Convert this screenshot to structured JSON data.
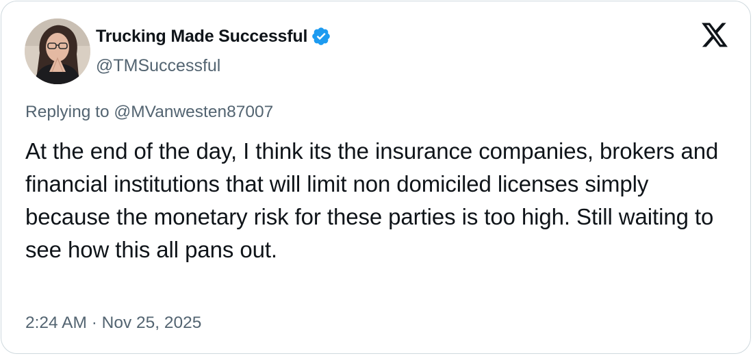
{
  "author": {
    "display_name": "Trucking Made Successful",
    "handle": "@TMSuccessful",
    "verified": true,
    "avatar_icon": "profile-photo"
  },
  "reply": {
    "prefix": "Replying to ",
    "to_handle": "@MVanwesten87007"
  },
  "tweet": {
    "text": "At the end of the day, I think its the insurance companies, brokers and financial institutions that will limit non domiciled licenses simply because the monetary risk for these parties is too high. Still waiting to see how this all pans out.",
    "timestamp": "2:24 AM · Nov 25, 2025"
  },
  "branding": {
    "logo_icon": "x-logo-icon"
  },
  "colors": {
    "text_primary": "#0f1419",
    "text_secondary": "#536471",
    "verified_blue": "#1d9bf0",
    "border": "#cfd9de"
  }
}
